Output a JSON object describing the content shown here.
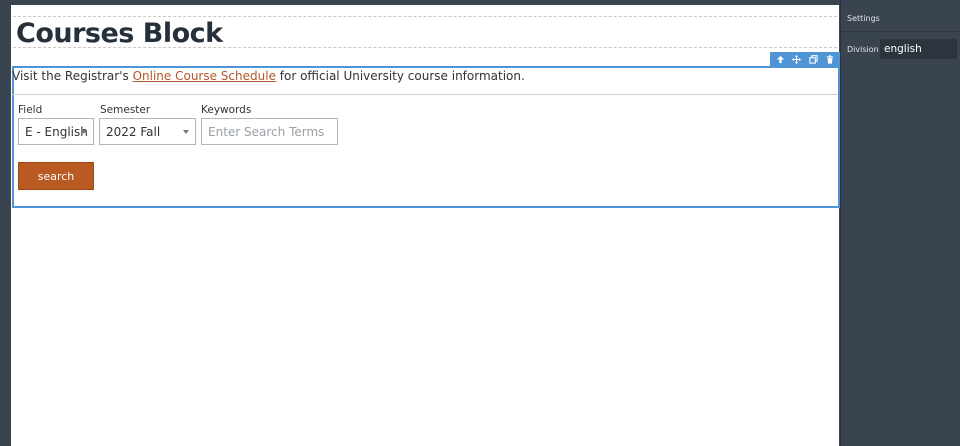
{
  "page": {
    "title": "Courses Block"
  },
  "block_toolbar": {
    "icons": [
      "arrow-up-icon",
      "move-icon",
      "duplicate-icon",
      "trash-icon"
    ]
  },
  "intro": {
    "before_link": "Visit the Registrar's ",
    "link_text": "Online Course Schedule",
    "after_link": " for official University course information."
  },
  "form": {
    "field_label": "Field",
    "field_value": "E - English",
    "semester_label": "Semester",
    "semester_value": "2022 Fall",
    "keywords_label": "Keywords",
    "keywords_placeholder": "Enter Search Terms",
    "keywords_value": "",
    "search_button": "search"
  },
  "settings": {
    "header": "Settings",
    "division_label": "Division",
    "division_value": "english"
  },
  "colors": {
    "accent_blue": "#4f94d4",
    "search_button": "#b85a22",
    "link": "#b4562b",
    "editor_bg": "#3a4450"
  }
}
